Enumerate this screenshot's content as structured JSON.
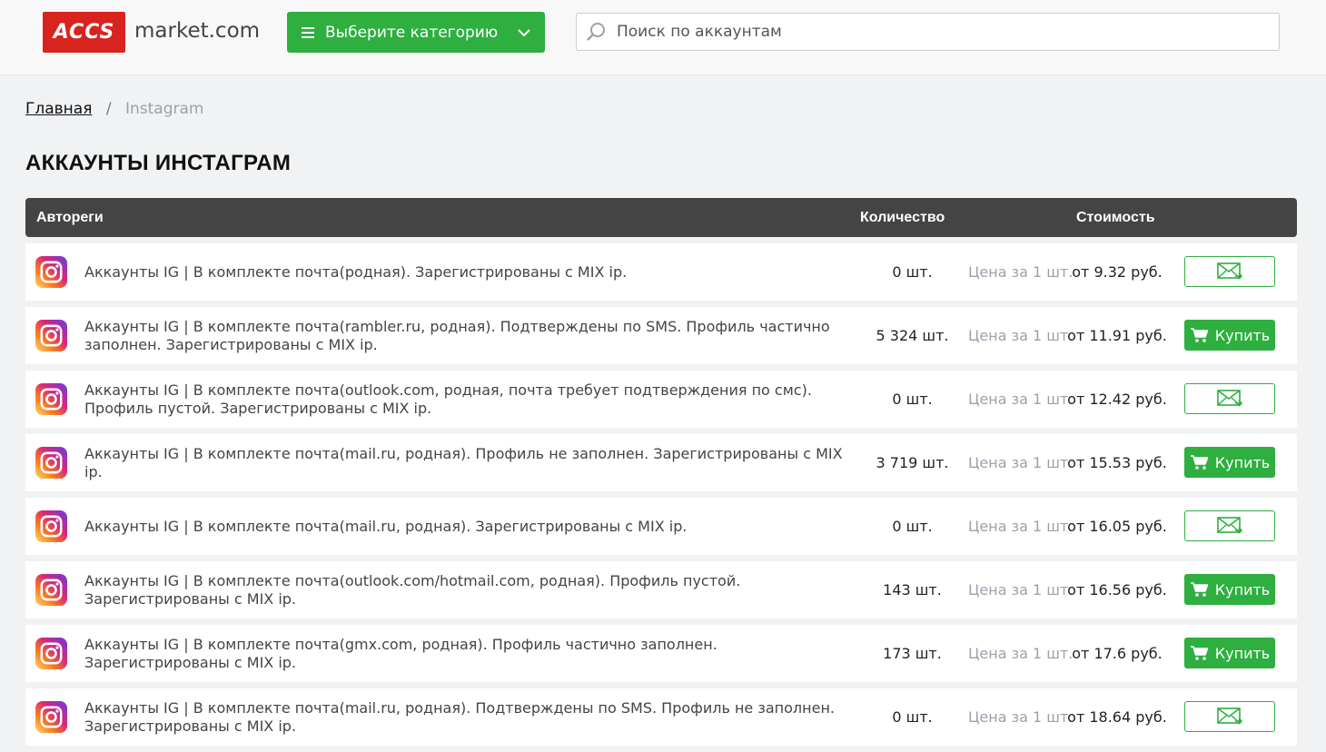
{
  "header": {
    "logo_text": "ACCS",
    "logo_domain": "market.com",
    "category_label": "Выберите категорию",
    "search_placeholder": "Поиск по аккаунтам"
  },
  "breadcrumb": {
    "home": "Главная",
    "separator": "/",
    "current": "Instagram"
  },
  "page_title": "АККАУНТЫ ИНСТАГРАМ",
  "table": {
    "headers": {
      "name": "Автореги",
      "quantity": "Количество",
      "price": "Стоимость"
    },
    "unit_label": "Цена за 1 шт.",
    "buy_label": "Купить",
    "rows": [
      {
        "desc": "Аккаунты IG | В комплекте почта(родная). Зарегистрированы с MIX ip.",
        "qty": "0 шт.",
        "price": "от 9.32 руб.",
        "action": "notify"
      },
      {
        "desc": "Аккаунты IG | В комплекте почта(rambler.ru, родная). Подтверждены по SMS. Профиль частично заполнен. Зарегистрированы с MIX ip.",
        "qty": "5 324 шт.",
        "price": "от 11.91 руб.",
        "action": "buy"
      },
      {
        "desc": "Аккаунты IG | В комплекте почта(outlook.com, родная, почта требует подтверждения по смс). Профиль пустой. Зарегистрированы с MIX ip.",
        "qty": "0 шт.",
        "price": "от 12.42 руб.",
        "action": "notify"
      },
      {
        "desc": "Аккаунты IG | В комплекте почта(mail.ru, родная). Профиль не заполнен. Зарегистрированы с MIX ip.",
        "qty": "3 719 шт.",
        "price": "от 15.53 руб.",
        "action": "buy"
      },
      {
        "desc": "Аккаунты IG | В комплекте почта(mail.ru, родная). Зарегистрированы с MIX ip.",
        "qty": "0 шт.",
        "price": "от 16.05 руб.",
        "action": "notify"
      },
      {
        "desc": "Аккаунты IG | В комплекте почта(outlook.com/hotmail.com, родная). Профиль пустой. Зарегистрированы с MIX ip.",
        "qty": "143 шт.",
        "price": "от 16.56 руб.",
        "action": "buy"
      },
      {
        "desc": "Аккаунты IG | В комплекте почта(gmx.com, родная). Профиль частично заполнен. Зарегистрированы с MIX ip.",
        "qty": "173 шт.",
        "price": "от 17.6 руб.",
        "action": "buy"
      },
      {
        "desc": "Аккаунты IG | В комплекте почта(mail.ru, родная). Подтверждены по SMS. Профиль не заполнен. Зарегистрированы с MIX ip.",
        "qty": "0 шт.",
        "price": "от 18.64 руб.",
        "action": "notify"
      }
    ]
  },
  "colors": {
    "accent": "#2eaf40",
    "logo_red": "#d8231f",
    "header_bar": "#444444"
  },
  "icons": {
    "menu": "hamburger-icon",
    "dropdown": "chevron-down-icon",
    "search": "search-icon",
    "row": "instagram-icon",
    "notify": "envelope-icon",
    "buy": "cart-icon"
  }
}
